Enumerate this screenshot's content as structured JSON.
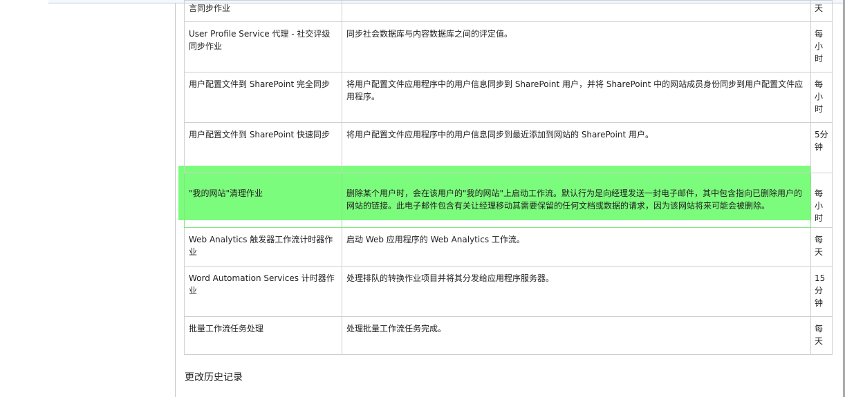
{
  "table": {
    "rows": [
      {
        "name": "言同步作业",
        "description": "",
        "frequency": "天"
      },
      {
        "name": "User Profile Service 代理 - 社交评级同步作业",
        "description": "同步社会数据库与内容数据库之间的评定值。",
        "frequency": "每小时"
      },
      {
        "name": "用户配置文件到 SharePoint 完全同步",
        "description": "将用户配置文件应用程序中的用户信息同步到 SharePoint 用户，并将 SharePoint 中的网站成员身份同步到用户配置文件应用程序。",
        "frequency": "每小时"
      },
      {
        "name": "用户配置文件到 SharePoint 快速同步",
        "description": "将用户配置文件应用程序中的用户信息同步到最近添加到网站的 SharePoint 用户。",
        "frequency": "5分钟"
      },
      {
        "name": "\"我的网站\"清理作业",
        "description": "删除某个用户时，会在该用户的\"我的网站\"上启动工作流。默认行为是向经理发送一封电子邮件，其中包含指向已删除用户的网站的链接。此电子邮件包含有关让经理移动其需要保留的任何文档或数据的请求，因为该网站将来可能会被删除。",
        "frequency": "每小时"
      },
      {
        "name": "Web Analytics 触发器工作流计时器作业",
        "description": "启动 Web 应用程序的 Web Analytics 工作流。",
        "frequency": "每天"
      },
      {
        "name": "Word Automation Services 计时器作业",
        "description": "处理排队的转换作业项目并将其分发给应用程序服务器。",
        "frequency": "15分钟"
      },
      {
        "name": "批量工作流任务处理",
        "description": "处理批量工作流任务完成。",
        "frequency": "每天"
      }
    ]
  },
  "section": {
    "title": "更改历史记录"
  },
  "colors": {
    "highlight": "#7cfc7c",
    "border": "#cfcfcf"
  }
}
